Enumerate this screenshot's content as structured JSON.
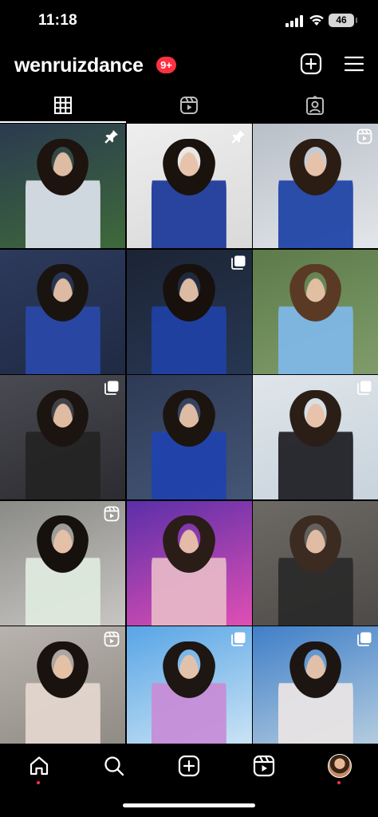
{
  "status_bar": {
    "time": "11:18",
    "battery": "46",
    "icons": [
      "signal-icon",
      "wifi-icon",
      "battery-icon"
    ]
  },
  "header": {
    "username": "wenruizdance",
    "notifications_badge": "9+",
    "icons": [
      "plus-square-icon",
      "hamburger-menu-icon"
    ]
  },
  "tabs": [
    {
      "name": "grid",
      "icon": "grid-icon",
      "active": true
    },
    {
      "name": "reels",
      "icon": "reels-icon",
      "active": false
    },
    {
      "name": "tagged",
      "icon": "tagged-person-icon",
      "active": false
    }
  ],
  "grid": [
    {
      "badge": "pin-icon",
      "bg": [
        "#2a3a4f",
        "#3e6a3a"
      ],
      "cloth": "#d9dfe8",
      "hair": "#1d140f"
    },
    {
      "badge": "pin-icon",
      "bg": [
        "#eeeeee",
        "#d9d9d9"
      ],
      "cloth": "#1f3c9b",
      "hair": "#1a120d"
    },
    {
      "badge": "reels-icon",
      "bg": [
        "#b8bfc8",
        "#e3e6ea"
      ],
      "cloth": "#2246a8",
      "hair": "#2b1d14"
    },
    {
      "badge": "",
      "bg": [
        "#2d3a5c",
        "#1f2a44"
      ],
      "cloth": "#2a48a7",
      "hair": "#1a1410"
    },
    {
      "badge": "carousel-icon",
      "bg": [
        "#1c2435",
        "#273752"
      ],
      "cloth": "#1f41a3",
      "hair": "#17100c"
    },
    {
      "badge": "",
      "bg": [
        "#5d7b4a",
        "#7f9c6a"
      ],
      "cloth": "#7fb8e6",
      "hair": "#5a3a25"
    },
    {
      "badge": "carousel-icon",
      "bg": [
        "#4a4a52",
        "#2b2b30"
      ],
      "cloth": "#242424",
      "hair": "#1b1410"
    },
    {
      "badge": "",
      "bg": [
        "#2e3a55",
        "#445676"
      ],
      "cloth": "#2043ad",
      "hair": "#1c140f"
    },
    {
      "badge": "carousel-icon",
      "bg": [
        "#dfe5ea",
        "#c8d3dc"
      ],
      "cloth": "#222228",
      "hair": "#2a1e17"
    },
    {
      "badge": "reels-icon",
      "bg": [
        "#8a8a86",
        "#c8c6c2"
      ],
      "cloth": "#dfeade",
      "hair": "#17110d"
    },
    {
      "badge": "",
      "bg": [
        "#5b2fa8",
        "#e04fb4"
      ],
      "cloth": "#e6b6c8",
      "hair": "#2a1d17"
    },
    {
      "badge": "",
      "bg": [
        "#6d6a66",
        "#4d4a47"
      ],
      "cloth": "#2b2b2b",
      "hair": "#3b2b21"
    },
    {
      "badge": "reels-icon",
      "bg": [
        "#b9b3ad",
        "#8f8984"
      ],
      "cloth": "#e3d6ce",
      "hair": "#1a120e"
    },
    {
      "badge": "carousel-icon",
      "bg": [
        "#58a5e6",
        "#cfe6f5"
      ],
      "cloth": "#c78fd8",
      "hair": "#1d1612"
    },
    {
      "badge": "carousel-icon",
      "bg": [
        "#3f7fc8",
        "#b9cfe0"
      ],
      "cloth": "#e8e4e4",
      "hair": "#1c1511"
    }
  ],
  "bottom_nav": [
    {
      "name": "home",
      "icon": "home-icon",
      "active": true
    },
    {
      "name": "search",
      "icon": "search-icon",
      "active": false
    },
    {
      "name": "create",
      "icon": "plus-square-icon",
      "active": false
    },
    {
      "name": "reels",
      "icon": "reels-icon",
      "active": false
    },
    {
      "name": "profile",
      "icon": "avatar",
      "active": false
    }
  ],
  "colors": {
    "background": "#000000",
    "text": "#ffffff",
    "notification": "#ff3040",
    "battery_bg": "#d6d6d6"
  }
}
